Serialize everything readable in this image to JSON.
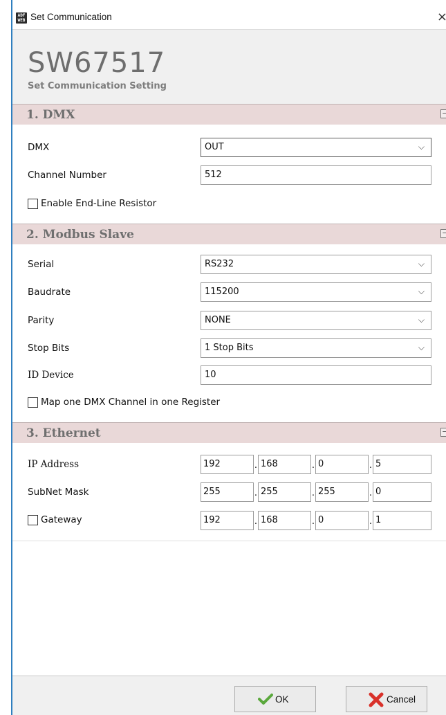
{
  "window": {
    "title": "Set Communication",
    "icon_text": "ADF WEB",
    "close_glyph": "×"
  },
  "header": {
    "model": "SW67517",
    "subtitle": "Set Communication Setting"
  },
  "sections": {
    "dmx": {
      "title": "1. DMX",
      "dmx_label": "DMX",
      "dmx_value": "OUT",
      "channel_label": "Channel Number",
      "channel_value": "512",
      "endline_label": "Enable End-Line Resistor",
      "endline_checked": false
    },
    "modbus": {
      "title": "2. Modbus Slave",
      "serial_label": "Serial",
      "serial_value": "RS232",
      "baud_label": "Baudrate",
      "baud_value": "115200",
      "parity_label": "Parity",
      "parity_value": "NONE",
      "stop_label": "Stop Bits",
      "stop_value": "1 Stop Bits",
      "id_label": "ID Device",
      "id_value": "10",
      "map_label": "Map one DMX Channel in one Register",
      "map_checked": false
    },
    "ethernet": {
      "title": "3. Ethernet",
      "ip_label": "IP Address",
      "ip": [
        "192",
        "168",
        "0",
        "5"
      ],
      "mask_label": "SubNet Mask",
      "mask": [
        "255",
        "255",
        "255",
        "0"
      ],
      "gw_label": "Gateway",
      "gw_checked": false,
      "gw": [
        "192",
        "168",
        "0",
        "1"
      ]
    }
  },
  "buttons": {
    "ok": "OK",
    "cancel": "Cancel"
  },
  "icons": {
    "collapse": "collapse-icon",
    "dropdown": "chevron-down-icon",
    "ok": "checkmark-icon",
    "cancel": "x-icon"
  },
  "colors": {
    "section_header": "#e9d8d8",
    "window_border": "#2f7fbf",
    "ok_check": "#5aa83c",
    "cancel_x": "#d9312a"
  }
}
